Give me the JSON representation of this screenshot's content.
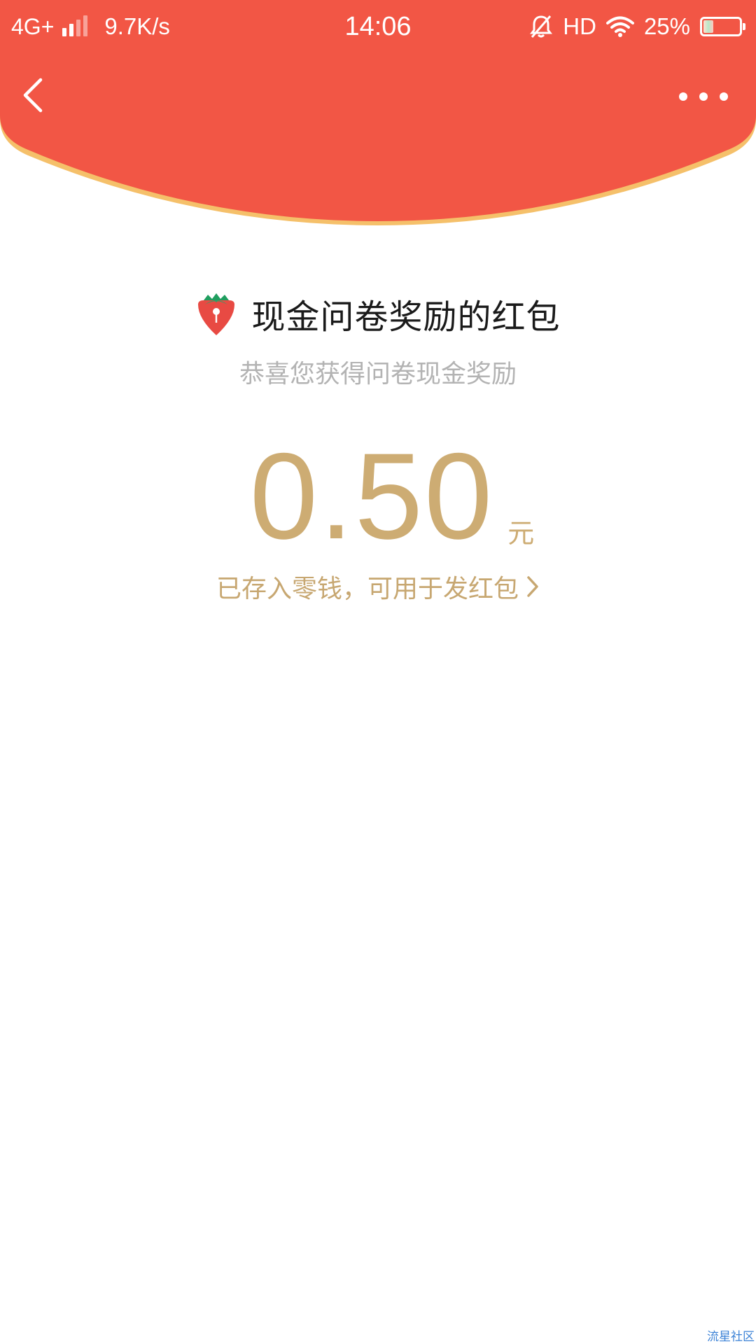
{
  "status_bar": {
    "network": "4G+",
    "speed": "9.7K/s",
    "time": "14:06",
    "hd": "HD",
    "battery": "25%",
    "battery_level": 0.25
  },
  "nav": {
    "back_icon": "chevron-left-icon",
    "more_icon": "more-dots-icon"
  },
  "content": {
    "title": "现金问卷奖励的红包",
    "title_icon": "strawberry-icon",
    "subtitle": "恭喜您获得问卷现金奖励",
    "amount": "0.50",
    "unit": "元",
    "deposit_text": "已存入零钱，可用于发红包"
  },
  "watermark": "流星社区",
  "colors": {
    "header_red": "#f25645",
    "header_border": "#f5c06a",
    "gold": "#cdac73",
    "subtitle_gray": "#b3b3b3",
    "title_black": "#1a1a1a"
  }
}
